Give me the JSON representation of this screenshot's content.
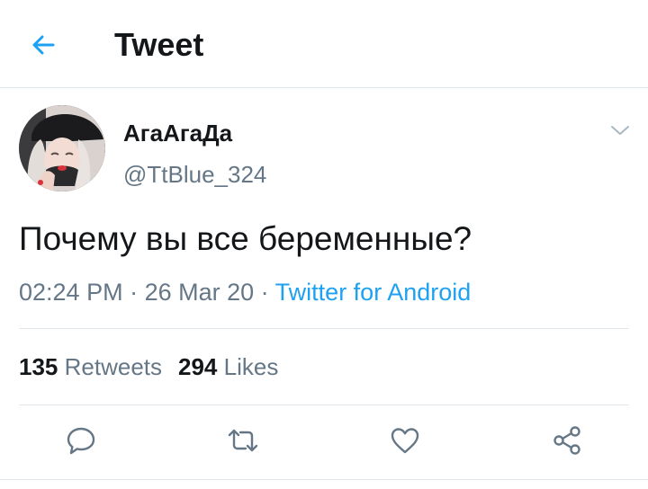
{
  "header": {
    "title": "Tweet",
    "back_icon": "arrow-left-icon"
  },
  "author": {
    "display_name": "АгаАгаДа",
    "handle": "@TtBlue_324"
  },
  "tweet": {
    "text": "Почему вы все беременные?",
    "time": "02:24 PM",
    "separator1": " · ",
    "date": "26 Mar 20",
    "separator2": " · ",
    "source": "Twitter for Android"
  },
  "stats": {
    "retweets_count": "135",
    "retweets_label": "Retweets",
    "likes_count": "294",
    "likes_label": "Likes"
  },
  "actions": [
    {
      "name": "reply",
      "icon": "speech-bubble-icon"
    },
    {
      "name": "retweet",
      "icon": "retweet-icon"
    },
    {
      "name": "like",
      "icon": "heart-icon"
    },
    {
      "name": "share",
      "icon": "share-icon"
    }
  ],
  "colors": {
    "accent": "#1da1f2",
    "text": "#14171a",
    "secondary": "#657786",
    "divider": "#e1e8ed"
  }
}
